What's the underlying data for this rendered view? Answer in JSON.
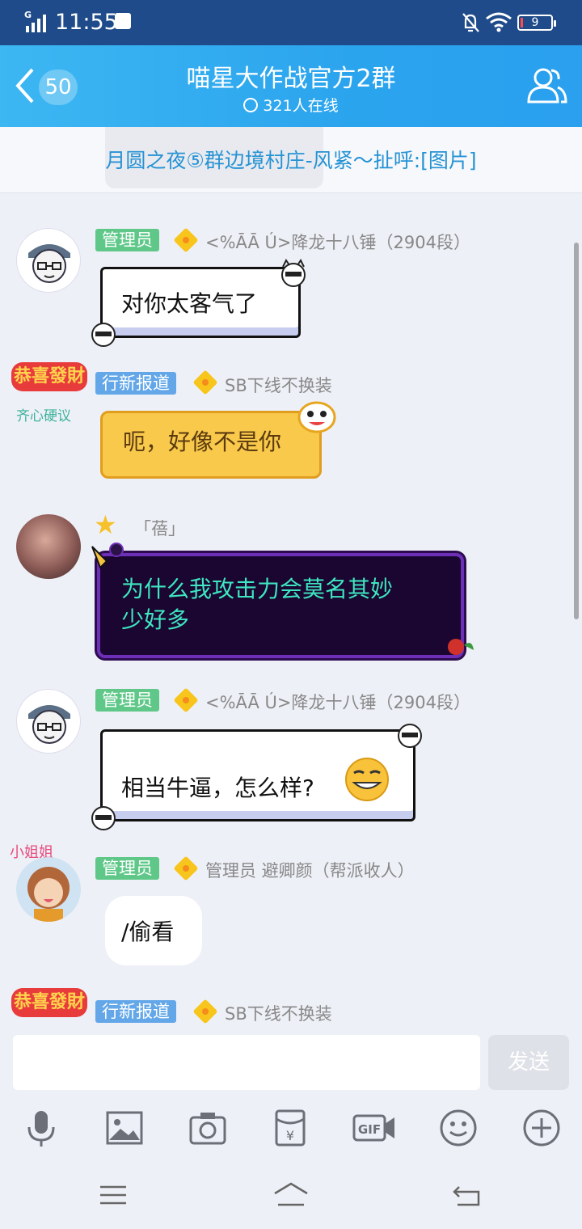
{
  "status_bar": {
    "time": "11:55",
    "network": "G",
    "battery": "9"
  },
  "header": {
    "back_count": "50",
    "title": "喵星大作战官方2群",
    "online": "321人在线"
  },
  "notice": {
    "text": "月圆之夜⑤群边境村庄-风紧～扯呼:[图片]"
  },
  "messages": [
    {
      "tag": "管理员",
      "nick": "<%ĀĀ Ú>降龙十八锤（2904段）",
      "text": "对你太客气了"
    },
    {
      "tag": "行新报道",
      "nick": "SB下线不换装",
      "badge_text_1": "恭喜發財",
      "badge_text_2": "齐心硬议",
      "text": "呃，好像不是你"
    },
    {
      "nick": "「蓓」",
      "text_line1": "为什么我攻击力会莫名其妙",
      "text_line2": "少好多"
    },
    {
      "tag": "管理员",
      "nick": "<%ĀĀ Ú>降龙十八锤（2904段）",
      "text": "相当牛逼，怎么样?"
    },
    {
      "tag": "管理员",
      "nick": "管理员 避卿颜（帮派收人）",
      "badge_text": "小姐姐",
      "text": "/偷看"
    },
    {
      "tag": "行新报道",
      "nick": "SB下线不换装",
      "badge_text_1": "恭喜發財"
    }
  ],
  "input": {
    "send_label": "发送"
  },
  "toolbar": [
    "mic-icon",
    "image-icon",
    "camera-icon",
    "red-packet-icon",
    "gif-icon",
    "emoji-icon",
    "plus-icon"
  ],
  "colors": {
    "header": "#2ba4ee",
    "status_bar": "#1f4b8a",
    "admin_tag": "#5fc889",
    "newbie_tag": "#63a7e8",
    "notice_text": "#2693d4"
  }
}
